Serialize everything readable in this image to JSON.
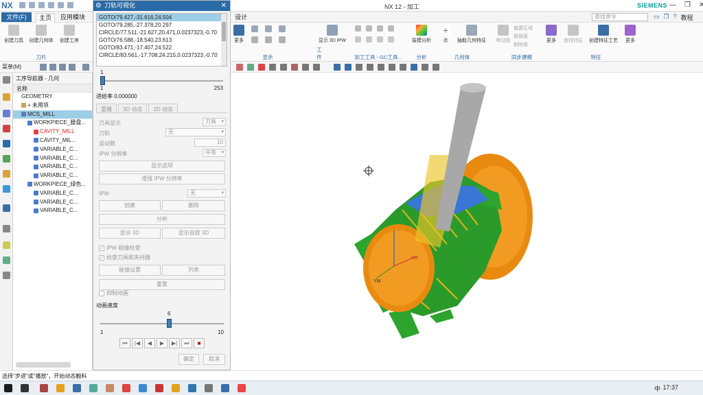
{
  "app": {
    "logo": "NX",
    "window_title": "NX 12 - 加工",
    "brand": "SIEMENS",
    "search_placeholder": "查找命令",
    "help": "教程"
  },
  "menubar": {
    "file": "文件(F)",
    "tabs": [
      "主页",
      "应用模块"
    ],
    "design_tab": "设计"
  },
  "ribbon": {
    "left_buttons": [
      "创建刀具",
      "创建几何体",
      "创建工序"
    ],
    "left_group": "刀片",
    "more": "更多",
    "groups": [
      {
        "label": "显示"
      },
      {
        "label": "工件"
      },
      {
        "label": "加工工具 - GC工具..."
      },
      {
        "label": "分析"
      },
      {
        "label": "几何体"
      },
      {
        "label": "同步建模"
      },
      {
        "label": "特征"
      }
    ],
    "buttons": {
      "show_3d_ipw": "显示 3D IPW",
      "collision": "拔模分析",
      "point": "点",
      "extract_geometry": "抽取几何特征",
      "move_face": "移动面",
      "replace_face": "替换面",
      "delete_face": "删除面",
      "offset_region": "偏置区域",
      "find_feature": "查找特征",
      "create_feature_process": "创建特征工艺"
    }
  },
  "toolbar2": {
    "menu": "菜单(M)"
  },
  "navigator": {
    "title": "工序导航器 - 几何",
    "column": "名称",
    "rows": [
      {
        "label": "GEOMETRY",
        "indent": 0,
        "icon_color": "#fff",
        "style": "normal"
      },
      {
        "label": "+ 未用项",
        "indent": 1,
        "icon_color": "#c9a45c",
        "style": "normal"
      },
      {
        "label": "MCS_MILL",
        "indent": 1,
        "icon_color": "#5a7fb8",
        "style": "selected"
      },
      {
        "label": "WORKPIECE_腰盘...",
        "indent": 2,
        "icon_color": "#4b7bd1",
        "style": "normal"
      },
      {
        "label": "CAVITY_MILL",
        "indent": 3,
        "icon_color": "#d44",
        "style": "red"
      },
      {
        "label": "CAVITY_MIL...",
        "indent": 3,
        "icon_color": "#4b7bd1",
        "style": "normal"
      },
      {
        "label": "VARIABLE_C...",
        "indent": 3,
        "icon_color": "#4b7bd1",
        "style": "normal"
      },
      {
        "label": "VARIABLE_C...",
        "indent": 3,
        "icon_color": "#4b7bd1",
        "style": "normal"
      },
      {
        "label": "VARIABLE_C...",
        "indent": 3,
        "icon_color": "#4b7bd1",
        "style": "normal"
      },
      {
        "label": "VARIABLE_C...",
        "indent": 3,
        "icon_color": "#4b7bd1",
        "style": "normal"
      },
      {
        "label": "WORKPIECE_绿色...",
        "indent": 2,
        "icon_color": "#4b7bd1",
        "style": "normal"
      },
      {
        "label": "VARIABLE_C...",
        "indent": 3,
        "icon_color": "#4b7bd1",
        "style": "normal"
      },
      {
        "label": "VARIABLE_C...",
        "indent": 3,
        "icon_color": "#4b7bd1",
        "style": "normal"
      },
      {
        "label": "VARIABLE_C...",
        "indent": 3,
        "icon_color": "#4b7bd1",
        "style": "normal"
      }
    ]
  },
  "dialog": {
    "title": "刀轨可视化",
    "gcode": [
      "GOTO/79.427,-31.616,24.504",
      "GOTO/79.285,-27.378,20.297",
      "CIRCLE/77.511,-21.627,20.471,0.0237323,-0.70",
      "GOTO/76.588,-18.540,23.613",
      "GOTO/83.471,-17.407,24.522",
      "CIRCLE/83.561,-17.708,24.215,0.0237323,-0.70"
    ],
    "selected_index": 0,
    "motion_slider": {
      "value": "1",
      "min": "1",
      "max": "253",
      "fraction": 0.0
    },
    "feed_rate": "进给率 0.000000",
    "tabs": [
      "重播",
      "3D 动态",
      "2D 动态"
    ],
    "options": {
      "tool_display_label": "刀具显示",
      "tool_display_value": "刀具",
      "toolpath_label": "刀轨",
      "toolpath_value": "无",
      "motion_count_label": "运动数",
      "motion_count_value": "10",
      "ipw_resolution_label": "IPW 分辨率",
      "ipw_resolution_value": "中等",
      "ipw_label": "IPW",
      "ipw_value": "无"
    },
    "buttons": {
      "display_options": "显示选项",
      "enhance_ipw": "增强 IPW 分辨率",
      "create": "创建",
      "delete": "删除",
      "analyze": "分析",
      "show_3d": "显示 3D",
      "show_auto_rotate": "显示自旋 3D",
      "collision_settings": "碰撞设置",
      "list": "列表",
      "reset": "重置",
      "ok": "确定",
      "cancel": "取消"
    },
    "checks": {
      "ipw_collision": "IPW 碰撞检查",
      "check_tool_holder": "检查刀具和夹持器",
      "suppress_animation": "抑制动画"
    },
    "speed": {
      "label": "动画速度",
      "value": "6",
      "min": "1",
      "max": "10",
      "fraction": 0.555
    }
  },
  "viewport": {
    "axis_xm": "XM",
    "axis_ym": "YM"
  },
  "status": "选择\"步进\"或\"播放\"，开始动态触料",
  "taskbar": {
    "time": "17:37",
    "ime": "中"
  }
}
